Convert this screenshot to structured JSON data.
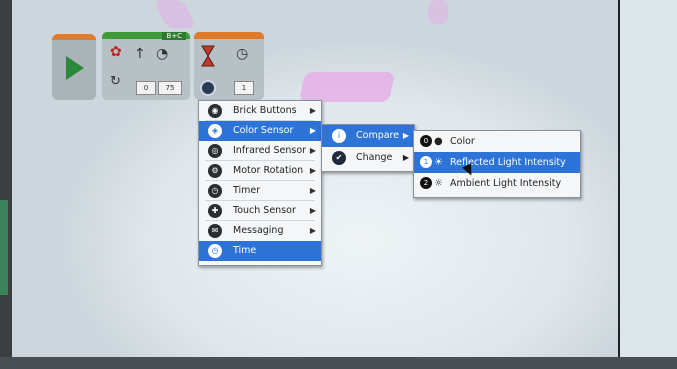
{
  "program": {
    "motor_port_label": "B+C",
    "motor_param_1": "0",
    "motor_param_2": "75",
    "wait_param": "1",
    "start_icon": "play-icon",
    "motor_icons": [
      "tank-steering-icon",
      "direction-arrow-icon",
      "rotation-icon"
    ],
    "wait_icons": [
      "hourglass-icon",
      "timer-icon"
    ]
  },
  "menu": {
    "items": [
      {
        "label": "Brick Buttons",
        "icon": "brick-buttons-icon",
        "glyph": "◉",
        "has_submenu": true,
        "selected": false
      },
      {
        "label": "Color Sensor",
        "icon": "color-sensor-icon",
        "glyph": "◈",
        "has_submenu": true,
        "selected": true
      },
      {
        "label": "Infrared Sensor",
        "icon": "infrared-sensor-icon",
        "glyph": "◎",
        "has_submenu": true,
        "selected": false
      },
      {
        "label": "Motor Rotation",
        "icon": "motor-rotation-icon",
        "glyph": "⚙",
        "has_submenu": true,
        "selected": false
      },
      {
        "label": "Timer",
        "icon": "timer-icon",
        "glyph": "◷",
        "has_submenu": true,
        "selected": false
      },
      {
        "label": "Touch Sensor",
        "icon": "touch-sensor-icon",
        "glyph": "✚",
        "has_submenu": true,
        "selected": false
      },
      {
        "label": "Messaging",
        "icon": "messaging-icon",
        "glyph": "✉",
        "has_submenu": true,
        "selected": false
      },
      {
        "label": "Time",
        "icon": "time-icon",
        "glyph": "◷",
        "has_submenu": false,
        "selected": true
      }
    ]
  },
  "submenu": {
    "items": [
      {
        "label": "Compare",
        "icon": "compare-icon",
        "glyph": "i",
        "selected": true
      },
      {
        "label": "Change",
        "icon": "change-icon",
        "glyph": "✔",
        "selected": false
      }
    ]
  },
  "leafmenu": {
    "items": [
      {
        "label": "Color",
        "num": "0",
        "symbol": "●",
        "icon": "color-icon",
        "selected": false
      },
      {
        "label": "Reflected Light Intensity",
        "num": "1",
        "symbol": "☀",
        "icon": "reflected-light-icon",
        "selected": true
      },
      {
        "label": "Ambient Light Intensity",
        "num": "2",
        "symbol": "☼",
        "icon": "ambient-light-icon",
        "selected": false
      }
    ]
  },
  "colors": {
    "selection": "#2d73d8",
    "start_block_top": "#e07b2c",
    "motor_block_top": "#3f9a3a",
    "menu_bg": "#f4f6f8"
  }
}
